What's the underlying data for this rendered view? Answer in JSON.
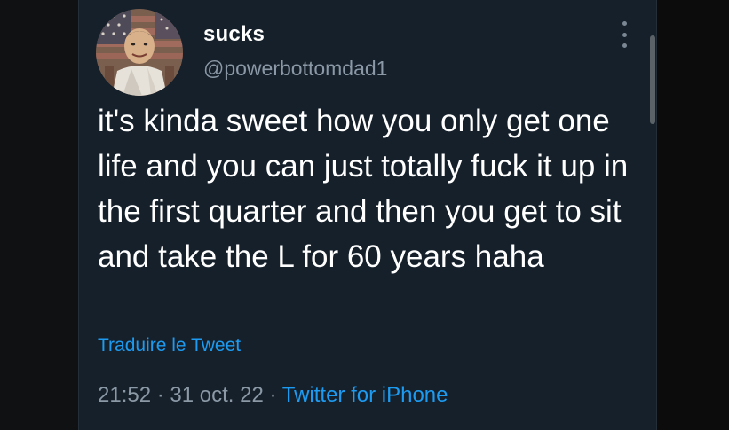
{
  "tweet": {
    "display_name": "sucks",
    "handle": "@powerbottomdad1",
    "text": "it's kinda sweet how you only get one life and you can just totally fuck it up in the first quarter and then you get to sit and take the L for 60 years haha",
    "translate_label": "Traduire le Tweet",
    "time": "21:52",
    "date": "31 oct. 22",
    "separator": "·",
    "source": "Twitter for iPhone"
  },
  "icons": {
    "more": "more-vertical-icon",
    "avatar": "profile-avatar"
  },
  "colors": {
    "background": "#15202b",
    "text": "#ffffff",
    "secondary": "#8b98a5",
    "accent": "#1d9bf0"
  }
}
